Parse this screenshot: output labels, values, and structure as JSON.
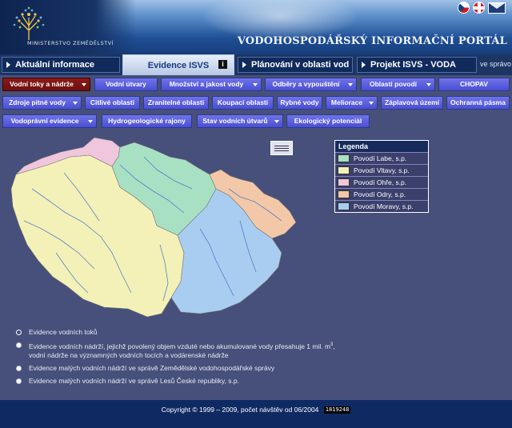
{
  "header": {
    "ministry": "MINISTERSTVO ZEMĚDĚLSTVÍ",
    "portal_title": "VODOHOSPODÁŘSKÝ INFORMAČNÍ PORTÁL",
    "icons": [
      "czech-flag-icon",
      "english-flag-icon",
      "mail-icon"
    ]
  },
  "main_tabs": [
    {
      "label": "Aktuální informace",
      "active": false
    },
    {
      "label": "Evidence ISVS",
      "active": true
    },
    {
      "label": "Plánování v oblasti vod",
      "active": false
    },
    {
      "label": "Projekt ISVS - VODA",
      "active": false
    }
  ],
  "main_nav_more": "ve správo",
  "sub_buttons": [
    {
      "label": "Vodní toky a nádrže",
      "dropdown": true,
      "selected": true
    },
    {
      "label": "Vodní útvary",
      "dropdown": false
    },
    {
      "label": "Množství a jakost vody",
      "dropdown": true
    },
    {
      "label": "Odběry a vypouštění",
      "dropdown": true
    },
    {
      "label": "Oblasti povodí",
      "dropdown": true
    },
    {
      "label": "CHOPAV",
      "dropdown": false
    },
    {
      "label": "Zdroje pitné vody",
      "dropdown": true
    },
    {
      "label": "Citlivé oblasti",
      "dropdown": false
    },
    {
      "label": "Zranitelné oblasti",
      "dropdown": false
    },
    {
      "label": "Koupací oblasti",
      "dropdown": false
    },
    {
      "label": "Rybné vody",
      "dropdown": false
    },
    {
      "label": "Meliorace",
      "dropdown": true
    },
    {
      "label": "Záplavová území",
      "dropdown": false
    },
    {
      "label": "Ochranná pásma",
      "dropdown": false
    },
    {
      "label": "Vodoprávní evidence",
      "dropdown": true
    },
    {
      "label": "Hydrogeologické rajony",
      "dropdown": false
    },
    {
      "label": "Stav vodních útvarů",
      "dropdown": true
    },
    {
      "label": "Ekologický potenciál",
      "dropdown": false
    }
  ],
  "legend": {
    "title": "Legenda",
    "items": [
      {
        "label": "Povodí Labe, s.p.",
        "color": "#a8e0c4"
      },
      {
        "label": "Povodí Vltavy, s.p.",
        "color": "#f3f1b8"
      },
      {
        "label": "Povodí Ohře, s.p.",
        "color": "#f0c6dc"
      },
      {
        "label": "Povodí Odry, s.p.",
        "color": "#f3c8a8"
      },
      {
        "label": "Povodí Moravy, s.p.",
        "color": "#a9cdf0"
      }
    ]
  },
  "links": [
    {
      "text": "Evidence vodních toků",
      "hollow": true
    },
    {
      "text": "Evidence vodních nádrží, jejichž povolený objem vzduté nebo akumulované vody přesahuje 1 mil. m",
      "sup": "3",
      "after": ",",
      "line2": "vodní nádrže na významných vodních tocích a vodárenské nádrže",
      "hollow": false
    },
    {
      "text": "Evidence malých vodních nádrží ve správě Zemědělské vodohospodářské správy",
      "hollow": false
    },
    {
      "text": "Evidence malých vodních nádrží ve správě Lesů České republiky, s.p.",
      "hollow": false
    }
  ],
  "footer": {
    "copyright": "Copyright © 1999 – 2009, počet návštěv od 06/2004",
    "counter": "1819248"
  }
}
